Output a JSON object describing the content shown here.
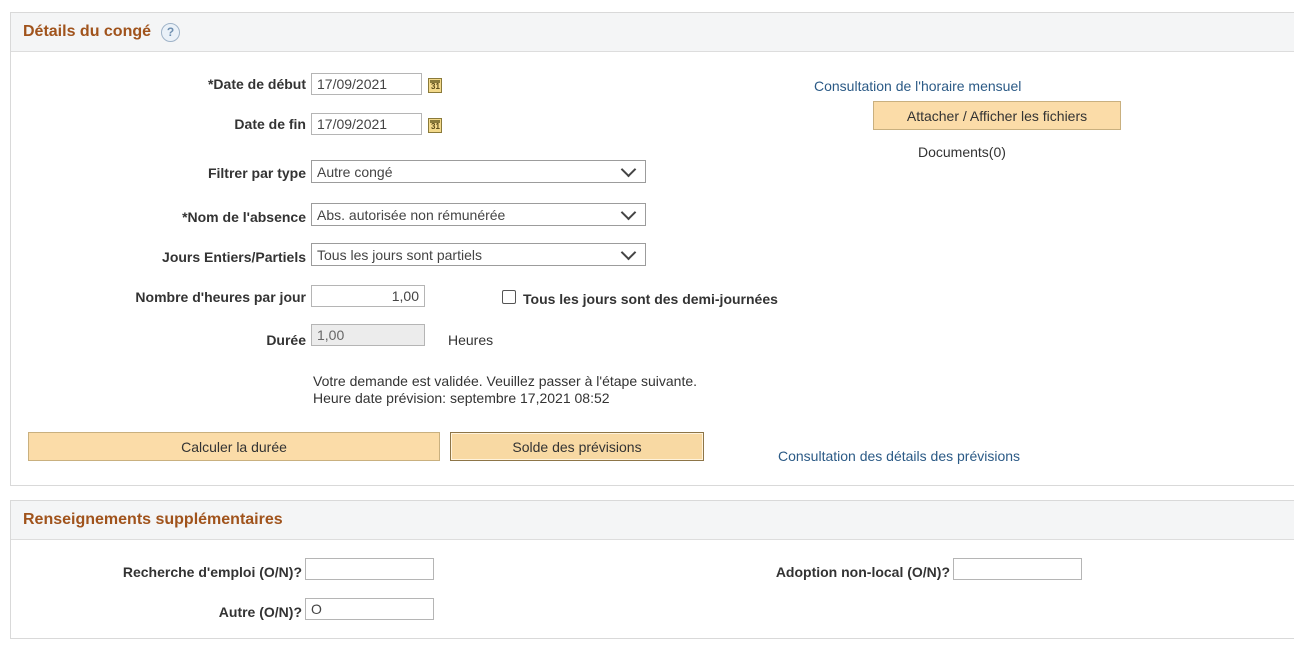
{
  "details": {
    "title": "Détails du congé",
    "help_icon": "?",
    "start_date": {
      "label": "*Date de début",
      "value": "17/09/2021"
    },
    "end_date": {
      "label": "Date de fin",
      "value": "17/09/2021"
    },
    "filter_type": {
      "label": "Filtrer par type",
      "value": "Autre congé"
    },
    "absence_name": {
      "label": "*Nom de l'absence",
      "value": "Abs. autorisée non rémunérée"
    },
    "partial_days": {
      "label": "Jours Entiers/Partiels",
      "value": "Tous les jours sont partiels"
    },
    "hours_per_day": {
      "label": "Nombre d'heures par jour",
      "value": "1,00"
    },
    "half_days_checkbox": {
      "label": "Tous les jours sont des demi-journées",
      "checked": false
    },
    "duration": {
      "label": "Durée",
      "value": "1,00",
      "unit": "Heures"
    },
    "message_line1": "Votre demande est validée. Veuillez passer à l'étape suivante.",
    "message_line2": "Heure date prévision: septembre 17,2021 08:52",
    "calculate_button": "Calculer la durée",
    "balance_button": "Solde des prévisions",
    "forecast_details_link": "Consultation des détails des prévisions",
    "monthly_schedule_link": "Consultation de l'horaire mensuel",
    "attach_button": "Attacher / Afficher les fichiers",
    "documents": "Documents(0)"
  },
  "extra": {
    "title": "Renseignements supplémentaires",
    "job_search": {
      "label": "Recherche d'emploi (O/N)?",
      "value": ""
    },
    "adoption": {
      "label": "Adoption non-local (O/N)?",
      "value": ""
    },
    "other": {
      "label": "Autre (O/N)?",
      "value": "O"
    }
  },
  "colors": {
    "section_title": "#a0531c",
    "button_bg": "#fbdca8",
    "link": "#2b5a86"
  }
}
